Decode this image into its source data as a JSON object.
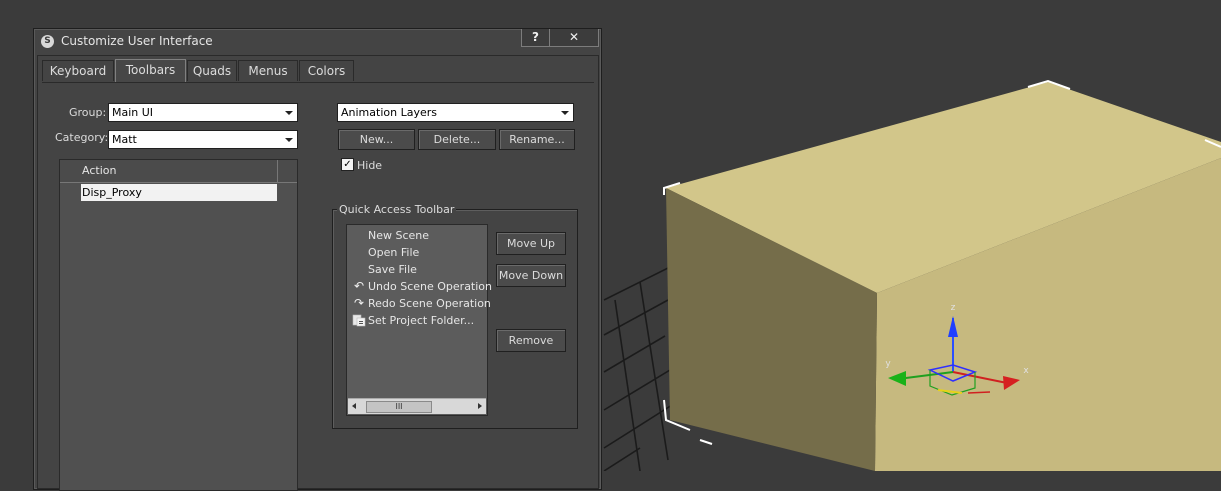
{
  "dialog": {
    "title": "Customize User Interface",
    "help_label": "?",
    "close_label": "✕",
    "tabs": [
      {
        "label": "Keyboard",
        "active": false
      },
      {
        "label": "Toolbars",
        "active": true
      },
      {
        "label": "Quads",
        "active": false
      },
      {
        "label": "Menus",
        "active": false
      },
      {
        "label": "Colors",
        "active": false
      }
    ]
  },
  "toolbars_tab": {
    "group_label": "Group:",
    "group_value": "Main UI",
    "category_label": "Category:",
    "category_value": "Matt",
    "action_header": "Action",
    "actions": [
      "Disp_Proxy"
    ],
    "toolbar_select_value": "Animation Layers",
    "new_label": "New...",
    "delete_label": "Delete...",
    "rename_label": "Rename...",
    "hide_label": "Hide",
    "hide_checked": true,
    "quick_access": {
      "title": "Quick Access Toolbar",
      "items": [
        {
          "label": "New Scene",
          "icon": "none"
        },
        {
          "label": "Open File",
          "icon": "none"
        },
        {
          "label": "Save File",
          "icon": "none"
        },
        {
          "label": "Undo Scene Operation",
          "icon": "undo-icon"
        },
        {
          "label": "Redo Scene Operation",
          "icon": "redo-icon"
        },
        {
          "label": "Set Project Folder...",
          "icon": "project-folder-icon"
        }
      ],
      "move_up_label": "Move Up",
      "move_down_label": "Move Down",
      "remove_label": "Remove",
      "scroll_thumb_glyph": "III"
    }
  },
  "viewport": {
    "background_color": "#3b3b3b",
    "grid_color": "#1b1b1b",
    "box_top_color": "#d2c68a",
    "box_front_color": "#c6b97f",
    "box_side_color": "#756d4a",
    "axis_labels": {
      "x": "x",
      "y": "y",
      "z": "z"
    }
  }
}
